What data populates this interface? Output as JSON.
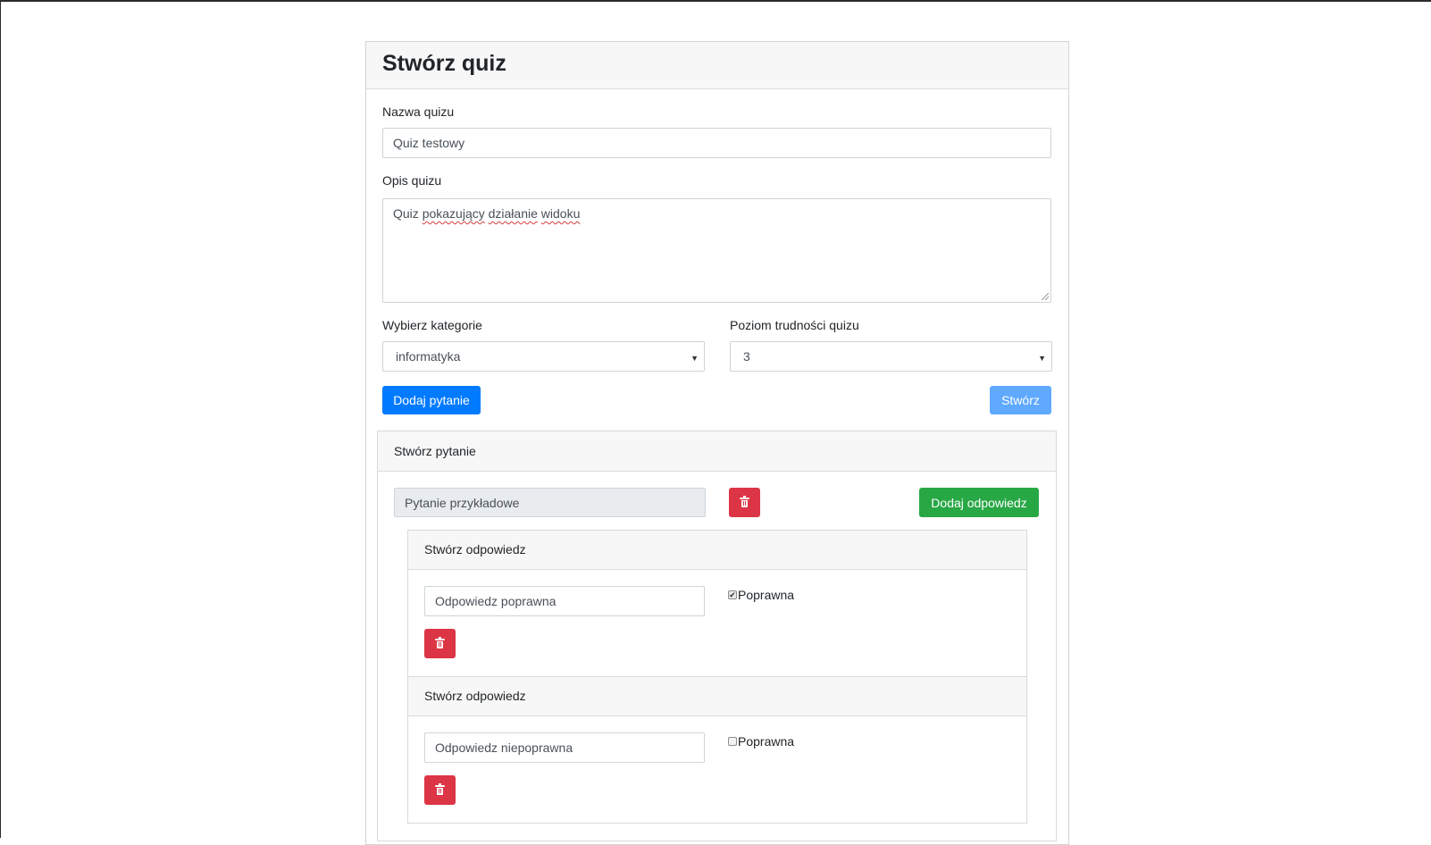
{
  "page": {
    "title": "Stwórz quiz"
  },
  "quiz_form": {
    "name_label": "Nazwa quizu",
    "name_value": "Quiz testowy",
    "description_label": "Opis quizu",
    "description_value_plain": "Quiz ",
    "description_value_underlined_1": "pokazujący",
    "description_value_sep_1": " ",
    "description_value_underlined_2": "działanie",
    "description_value_sep_2": " ",
    "description_value_underlined_3": "widoku",
    "category_label": "Wybierz kategorie",
    "category_value": "informatyka",
    "difficulty_label": "Poziom trudności quizu",
    "difficulty_value": "3",
    "add_question_label": "Dodaj pytanie",
    "create_label": "Stwórz"
  },
  "question": {
    "header": "Stwórz pytanie",
    "value": "Pytanie przykładowe",
    "add_answer_label": "Dodaj odpowiedz",
    "answers": [
      {
        "header": "Stwórz odpowiedz",
        "value": "Odpowiedz poprawna",
        "correct_label": "Poprawna",
        "checked": true
      },
      {
        "header": "Stwórz odpowiedz",
        "value": "Odpowiedz niepoprawna",
        "correct_label": "Poprawna",
        "checked": false
      }
    ]
  },
  "icons": {
    "delete": "trash-icon",
    "select_caret": "chevron-down-icon"
  },
  "colors": {
    "primary": "#007bff",
    "primary_disabled": "#5fa9ff",
    "success": "#28a745",
    "danger": "#dc3545",
    "card_header": "#f7f7f7",
    "readonly_field": "#e9ecef"
  }
}
